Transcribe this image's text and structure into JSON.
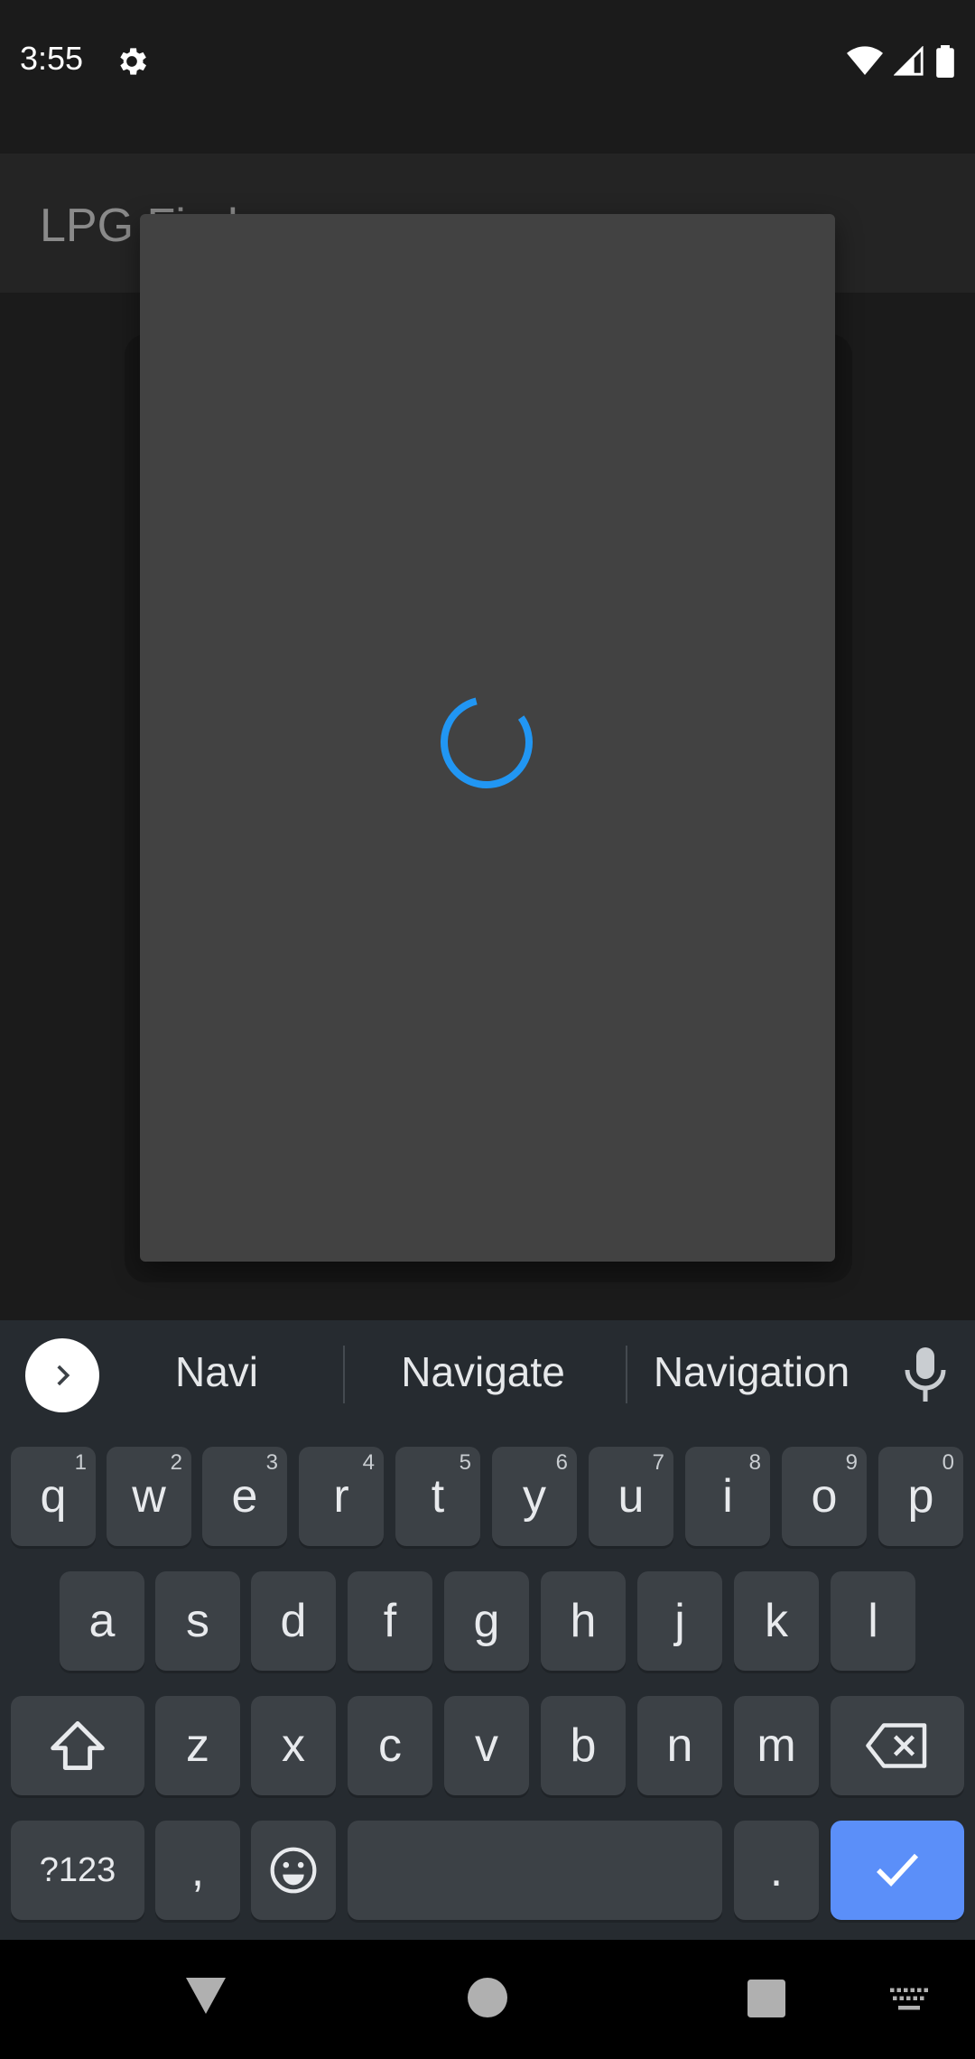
{
  "status_bar": {
    "time": "3:55"
  },
  "app_bar": {
    "title": "LPG Finder"
  },
  "suggestions": [
    "Navi",
    "Navigate",
    "Navigation"
  ],
  "keyboard": {
    "row1": [
      {
        "ch": "q",
        "num": "1"
      },
      {
        "ch": "w",
        "num": "2"
      },
      {
        "ch": "e",
        "num": "3"
      },
      {
        "ch": "r",
        "num": "4"
      },
      {
        "ch": "t",
        "num": "5"
      },
      {
        "ch": "y",
        "num": "6"
      },
      {
        "ch": "u",
        "num": "7"
      },
      {
        "ch": "i",
        "num": "8"
      },
      {
        "ch": "o",
        "num": "9"
      },
      {
        "ch": "p",
        "num": "0"
      }
    ],
    "row2": [
      "a",
      "s",
      "d",
      "f",
      "g",
      "h",
      "j",
      "k",
      "l"
    ],
    "row3": [
      "z",
      "x",
      "c",
      "v",
      "b",
      "n",
      "m"
    ],
    "symbols_label": "?123",
    "comma": ",",
    "period": "."
  },
  "colors": {
    "spinner": "#2196f3",
    "done_key": "#5b8ff9"
  }
}
